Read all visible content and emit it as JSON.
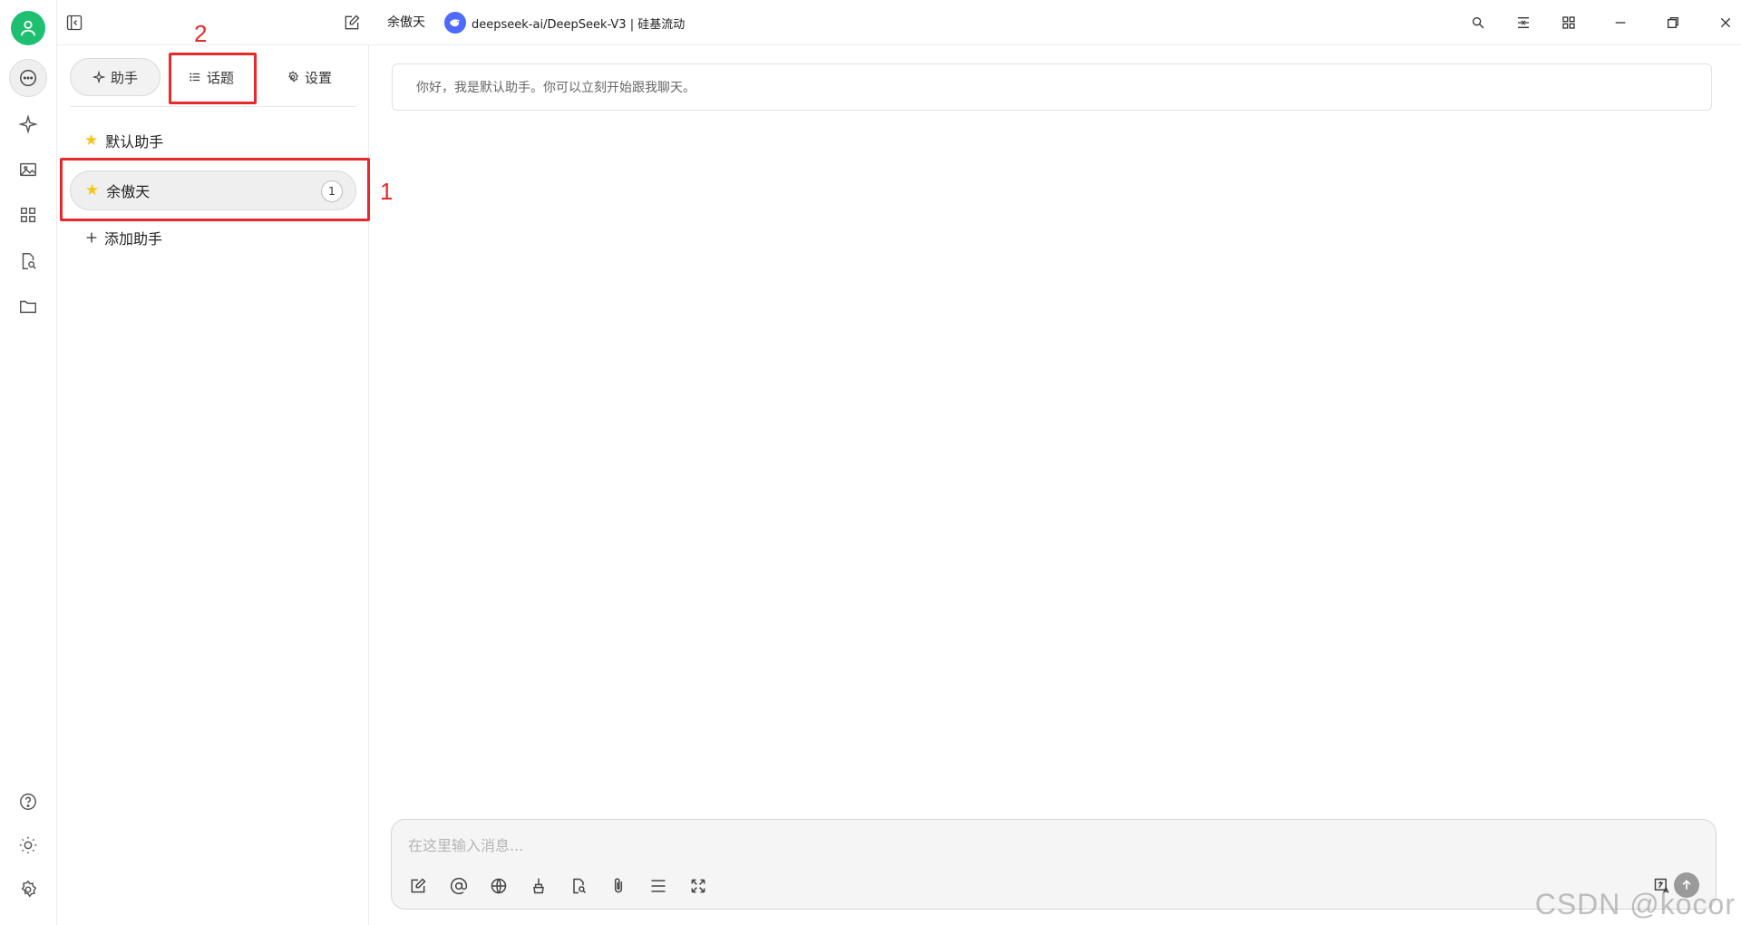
{
  "topbar": {
    "assistant_name": "余傲天",
    "model_label": "deepseek-ai/DeepSeek-V3 | 硅基流动"
  },
  "tabs": [
    {
      "label": "助手"
    },
    {
      "label": "话题"
    },
    {
      "label": "设置"
    }
  ],
  "assistants": [
    {
      "label": "默认助手"
    },
    {
      "label": "余傲天",
      "count": "1"
    }
  ],
  "add_assistant_label": "添加助手",
  "annotations": [
    "1",
    "2"
  ],
  "chat": {
    "greeting": "你好，我是默认助手。你可以立刻开始跟我聊天。"
  },
  "composer": {
    "placeholder": "在这里输入消息..."
  },
  "watermark": "CSDN @kocor",
  "colors": {
    "accent": "#1fbf72",
    "annotation": "#e8282b",
    "star": "#f5c518"
  }
}
